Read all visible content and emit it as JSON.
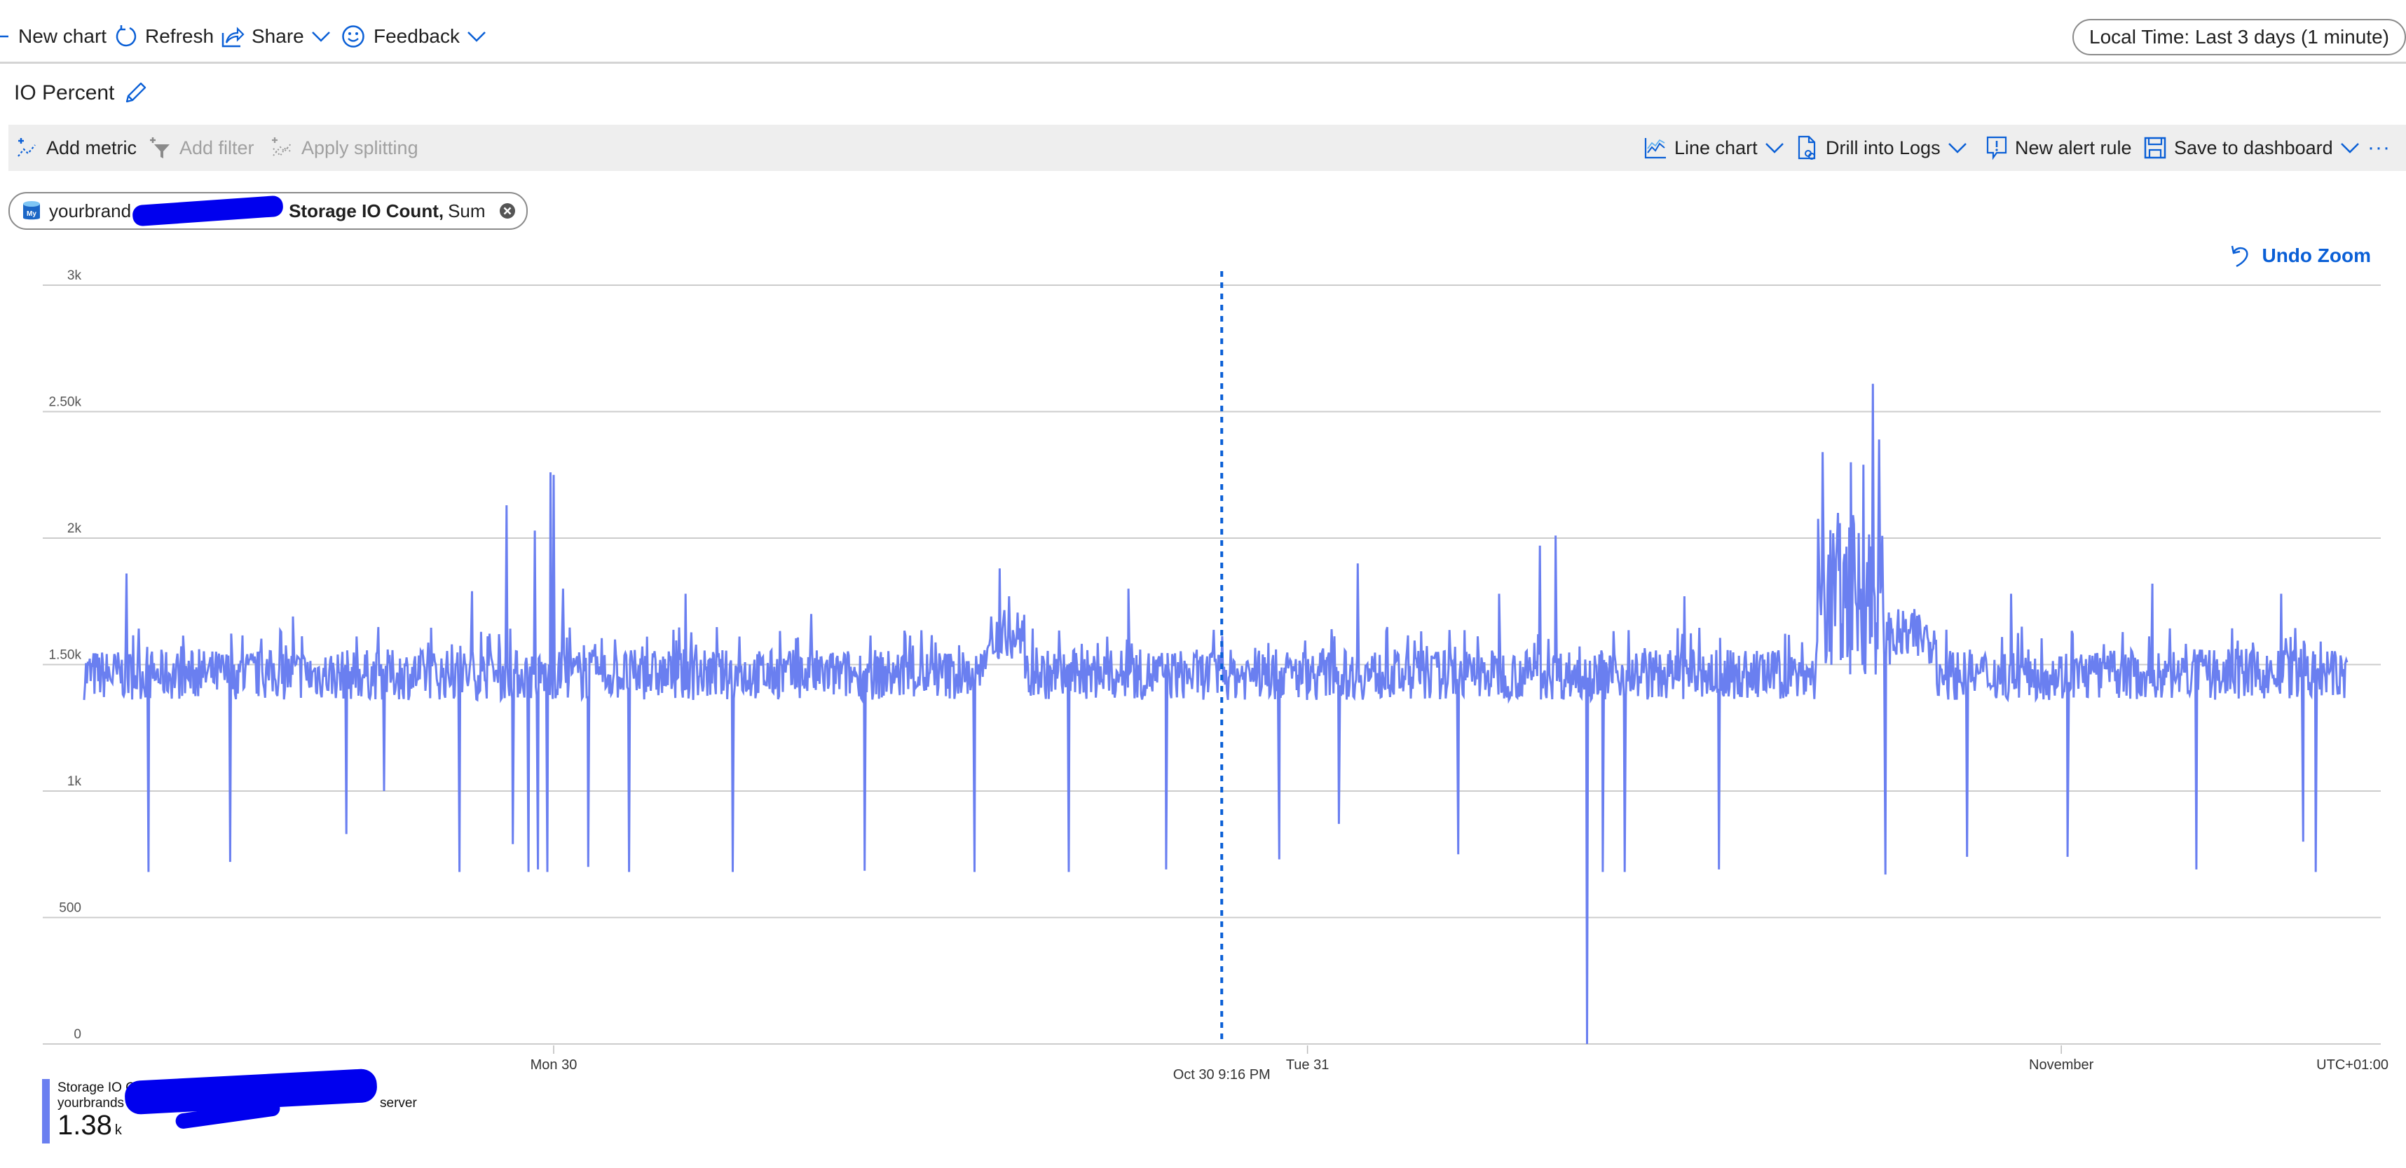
{
  "commandbar": {
    "new_chart": "New chart",
    "refresh": "Refresh",
    "share": "Share",
    "feedback": "Feedback",
    "time_range": "Local Time: Last 3 days (1 minute)"
  },
  "chart_title": "IO Percent",
  "metric_toolbar": {
    "add_metric": "Add metric",
    "add_filter": "Add filter",
    "apply_splitting": "Apply splitting",
    "line_chart": "Line chart",
    "drill_into_logs": "Drill into Logs",
    "new_alert_rule": "New alert rule",
    "save_to_dashboard": "Save to dashboard",
    "more": "···"
  },
  "metric_pill": {
    "resource": "yourbrand",
    "metric": "Storage IO Count,",
    "aggregation": "Sum"
  },
  "undo_zoom": "Undo Zoom",
  "legend": {
    "title": "Storage IO Count (Sum)",
    "resource_prefix": "yourbrands",
    "resource_suffix": "server",
    "value": "1.38",
    "unit": "k",
    "color": "#6a7ff0"
  },
  "chart_data": {
    "type": "line",
    "title": "IO Percent",
    "series_name": "Storage IO Count (Sum)",
    "color": "#6a7ff0",
    "ylim": [
      0,
      3000
    ],
    "y_ticks": [
      {
        "value": 0,
        "label": "0"
      },
      {
        "value": 500,
        "label": "500"
      },
      {
        "value": 1000,
        "label": "1k"
      },
      {
        "value": 1500,
        "label": "1.50k"
      },
      {
        "value": 2000,
        "label": "2k"
      },
      {
        "value": 2500,
        "label": "2.50k"
      },
      {
        "value": 3000,
        "label": "3k"
      }
    ],
    "x_range_hours": [
      -14.95,
      57.1
    ],
    "x_ticks": [
      {
        "hours": 0,
        "label": "Mon 30"
      },
      {
        "hours": 24,
        "label": "Tue 31"
      },
      {
        "hours": 48,
        "label": "November"
      }
    ],
    "timezone_label": "UTC+01:00",
    "cursor": {
      "hours": 21.27,
      "label": "Oct 30 9:16 PM"
    },
    "grid": true,
    "baseline": {
      "low": 1360,
      "high": 1560,
      "typical_peak": 1650
    },
    "spikes_up": [
      {
        "hours": -13.6,
        "value": 1860
      },
      {
        "hours": -8.3,
        "value": 1690
      },
      {
        "hours": -2.6,
        "value": 1790
      },
      {
        "hours": -1.5,
        "value": 2130
      },
      {
        "hours": 0.3,
        "value": 1800
      },
      {
        "hours": -0.6,
        "value": 2030
      },
      {
        "hours": -0.1,
        "value": 2260
      },
      {
        "hours": 0.0,
        "value": 2250
      },
      {
        "hours": 2.4,
        "value": 1850
      },
      {
        "hours": 4.2,
        "value": 1780
      },
      {
        "hours": 8.2,
        "value": 1700
      },
      {
        "hours": 14.2,
        "value": 1880
      },
      {
        "hours": 14.5,
        "value": 1770
      },
      {
        "hours": 18.3,
        "value": 1800
      },
      {
        "hours": 25.6,
        "value": 1900
      },
      {
        "hours": 30.1,
        "value": 1780
      },
      {
        "hours": 31.4,
        "value": 1970
      },
      {
        "hours": 31.9,
        "value": 2010
      },
      {
        "hours": 36.0,
        "value": 1770
      },
      {
        "hours": 40.4,
        "value": 2340
      },
      {
        "hours": 41.3,
        "value": 2300
      },
      {
        "hours": 41.7,
        "value": 2290
      },
      {
        "hours": 42.0,
        "value": 2610
      },
      {
        "hours": 42.2,
        "value": 2390
      },
      {
        "hours": 46.4,
        "value": 1780
      },
      {
        "hours": 50.9,
        "value": 1820
      },
      {
        "hours": 55.0,
        "value": 1780
      }
    ],
    "plateaus": [
      {
        "from_hours": 40.2,
        "to_hours": 42.3,
        "low": 1450,
        "high": 2100
      },
      {
        "from_hours": 42.3,
        "to_hours": 44.0,
        "low": 1500,
        "high": 1720
      },
      {
        "from_hours": 13.8,
        "to_hours": 15.0,
        "low": 1520,
        "high": 1720
      }
    ],
    "dips": [
      {
        "hours": -12.9,
        "value": 680
      },
      {
        "hours": -10.3,
        "value": 720
      },
      {
        "hours": -6.6,
        "value": 830
      },
      {
        "hours": -5.4,
        "value": 1000
      },
      {
        "hours": -3.0,
        "value": 680
      },
      {
        "hours": -1.3,
        "value": 790
      },
      {
        "hours": -0.8,
        "value": 680
      },
      {
        "hours": -0.5,
        "value": 690
      },
      {
        "hours": -0.2,
        "value": 680
      },
      {
        "hours": 1.1,
        "value": 700
      },
      {
        "hours": 2.4,
        "value": 680
      },
      {
        "hours": 5.7,
        "value": 680
      },
      {
        "hours": 9.9,
        "value": 685
      },
      {
        "hours": 13.4,
        "value": 680
      },
      {
        "hours": 16.4,
        "value": 680
      },
      {
        "hours": 19.5,
        "value": 690
      },
      {
        "hours": 23.1,
        "value": 730
      },
      {
        "hours": 25.0,
        "value": 870
      },
      {
        "hours": 28.8,
        "value": 750
      },
      {
        "hours": 32.9,
        "value": 0
      },
      {
        "hours": 33.4,
        "value": 680
      },
      {
        "hours": 34.1,
        "value": 680
      },
      {
        "hours": 37.1,
        "value": 690
      },
      {
        "hours": 42.4,
        "value": 670
      },
      {
        "hours": 45.0,
        "value": 740
      },
      {
        "hours": 48.2,
        "value": 740
      },
      {
        "hours": 52.3,
        "value": 690
      },
      {
        "hours": 56.1,
        "value": 680
      },
      {
        "hours": 55.7,
        "value": 800
      }
    ]
  }
}
